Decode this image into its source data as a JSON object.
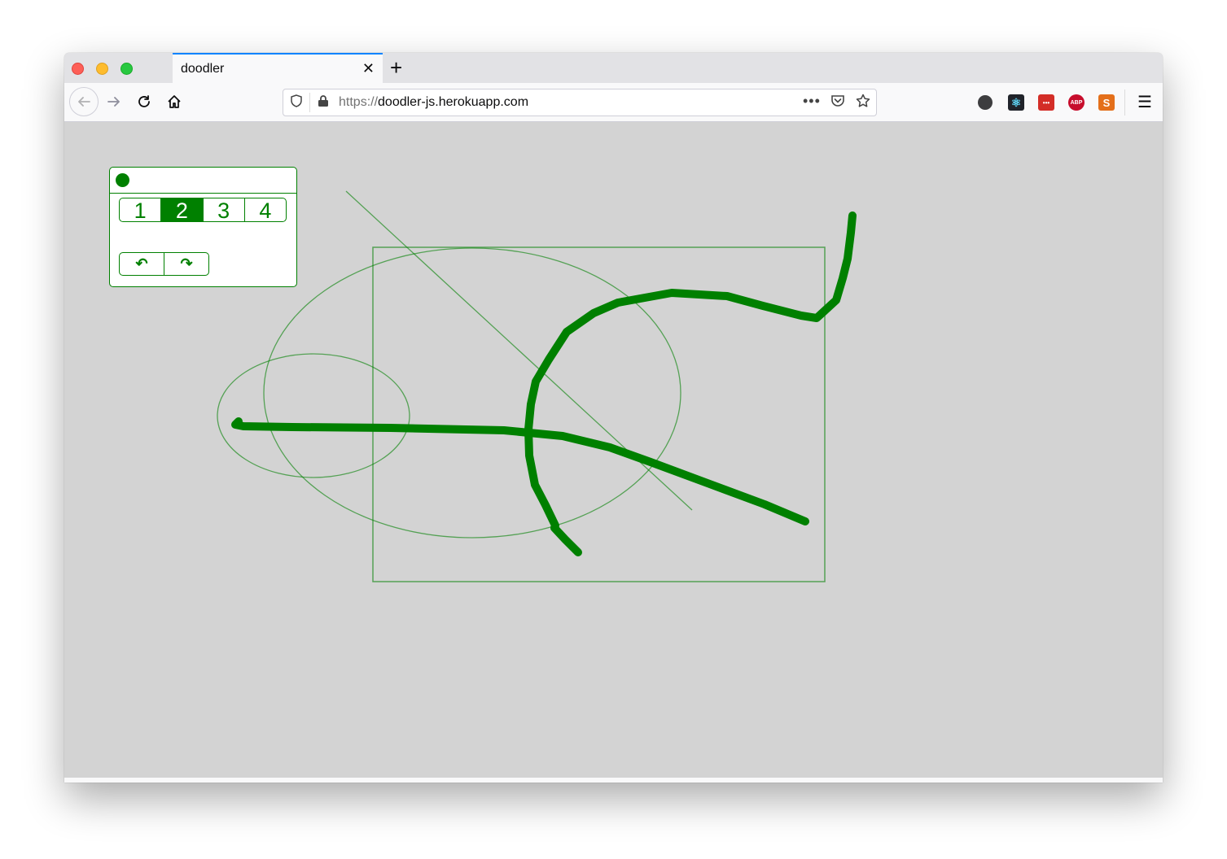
{
  "browser": {
    "tab_title": "doodler",
    "url_protocol": "https://",
    "url_host": "doodler-js.herokuapp.com",
    "toolbar_icons": [
      "back-arrow-icon",
      "forward-arrow-icon",
      "reload-icon",
      "home-icon"
    ],
    "urlbar_icons": [
      "shield-icon",
      "lock-icon",
      "more-icon",
      "pocket-icon",
      "star-icon"
    ],
    "extensions": [
      {
        "name": "account-icon",
        "label": "",
        "color": "#3d3d3f"
      },
      {
        "name": "react-devtools-icon",
        "label": "⚛",
        "color": "#20232a"
      },
      {
        "name": "lastpass-icon",
        "label": "•••",
        "color": "#d32d27"
      },
      {
        "name": "adblock-plus-icon",
        "label": "ABP",
        "color": "#c70d2c"
      },
      {
        "name": "sublime-icon",
        "label": "S",
        "color": "#e46f1a"
      }
    ]
  },
  "toolbox": {
    "selected_color": "#008000",
    "sizes": [
      "1",
      "2",
      "3",
      "4"
    ],
    "active_size": "2",
    "undo_label": "↶",
    "redo_label": "↷"
  },
  "canvas": {
    "background": "#d3d3d3",
    "stroke_color": "#008000",
    "shapes": [
      "line",
      "rectangle",
      "large-ellipse",
      "small-ellipse",
      "freehand-stroke-1",
      "freehand-stroke-2"
    ]
  }
}
